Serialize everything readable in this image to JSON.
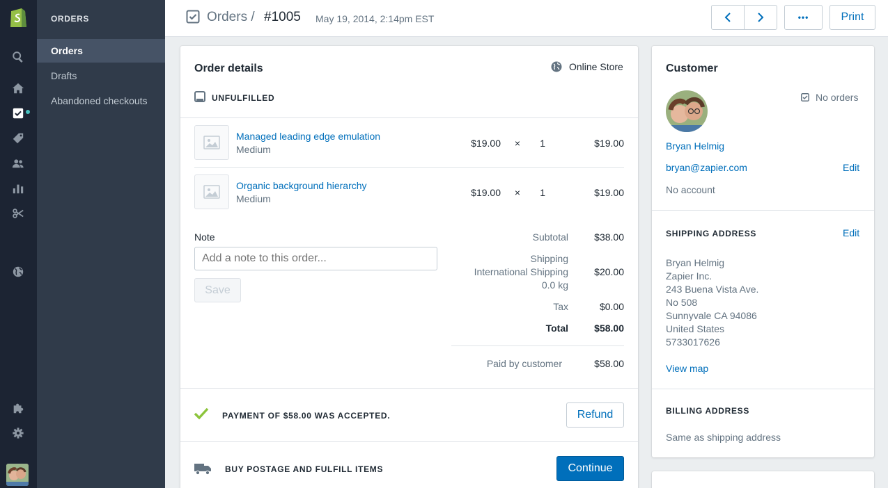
{
  "sidebar": {
    "title": "ORDERS",
    "items": [
      {
        "label": "Orders",
        "active": true
      },
      {
        "label": "Drafts"
      },
      {
        "label": "Abandoned checkouts"
      }
    ],
    "icons": [
      "shopify-logo-icon",
      "search-icon",
      "home-icon",
      "orders-icon",
      "tag-icon",
      "customers-icon",
      "analytics-icon",
      "discounts-icon",
      "online-store-icon",
      "apps-icon",
      "settings-icon"
    ]
  },
  "header": {
    "breadcrumb": "Orders /",
    "order_number": "#1005",
    "date": "May 19, 2014, 2:14pm EST",
    "more_label": "•••",
    "print_label": "Print"
  },
  "order": {
    "title": "Order details",
    "channel": "Online Store",
    "status": "UNFULFILLED",
    "line_items": [
      {
        "name": "Managed leading edge emulation",
        "variant": "Medium",
        "price": "$19.00",
        "times": "×",
        "qty": "1",
        "total": "$19.00"
      },
      {
        "name": "Organic background hierarchy",
        "variant": "Medium",
        "price": "$19.00",
        "times": "×",
        "qty": "1",
        "total": "$19.00"
      }
    ],
    "note_label": "Note",
    "note_placeholder": "Add a note to this order...",
    "save_label": "Save",
    "summary": {
      "subtotal_label": "Subtotal",
      "subtotal": "$38.00",
      "shipping_label": "Shipping",
      "shipping_method": "International Shipping",
      "shipping_weight": "0.0 kg",
      "shipping": "$20.00",
      "tax_label": "Tax",
      "tax": "$0.00",
      "total_label": "Total",
      "total": "$58.00",
      "paid_label": "Paid by customer",
      "paid": "$58.00"
    },
    "payment_text": "PAYMENT OF $58.00 WAS ACCEPTED.",
    "refund_label": "Refund",
    "fulfill_text": "BUY POSTAGE AND FULFILL ITEMS",
    "continue_label": "Continue"
  },
  "customer": {
    "title": "Customer",
    "orders": "No orders",
    "name": "Bryan Helmig",
    "email": "bryan@zapier.com",
    "edit_label": "Edit",
    "account": "No account",
    "shipping_title": "SHIPPING ADDRESS",
    "shipping_edit_label": "Edit",
    "address": [
      "Bryan Helmig",
      "Zapier Inc.",
      "243 Buena Vista Ave.",
      "No 508",
      "Sunnyvale CA 94086",
      "United States",
      "5733017626"
    ],
    "view_map_label": "View map",
    "billing_title": "BILLING ADDRESS",
    "billing_text": "Same as shipping address"
  },
  "colors": {
    "accent": "#006fbb",
    "sidebar_dark": "#1c2433",
    "sidebar": "#303b4a",
    "success": "#8cc43b"
  }
}
